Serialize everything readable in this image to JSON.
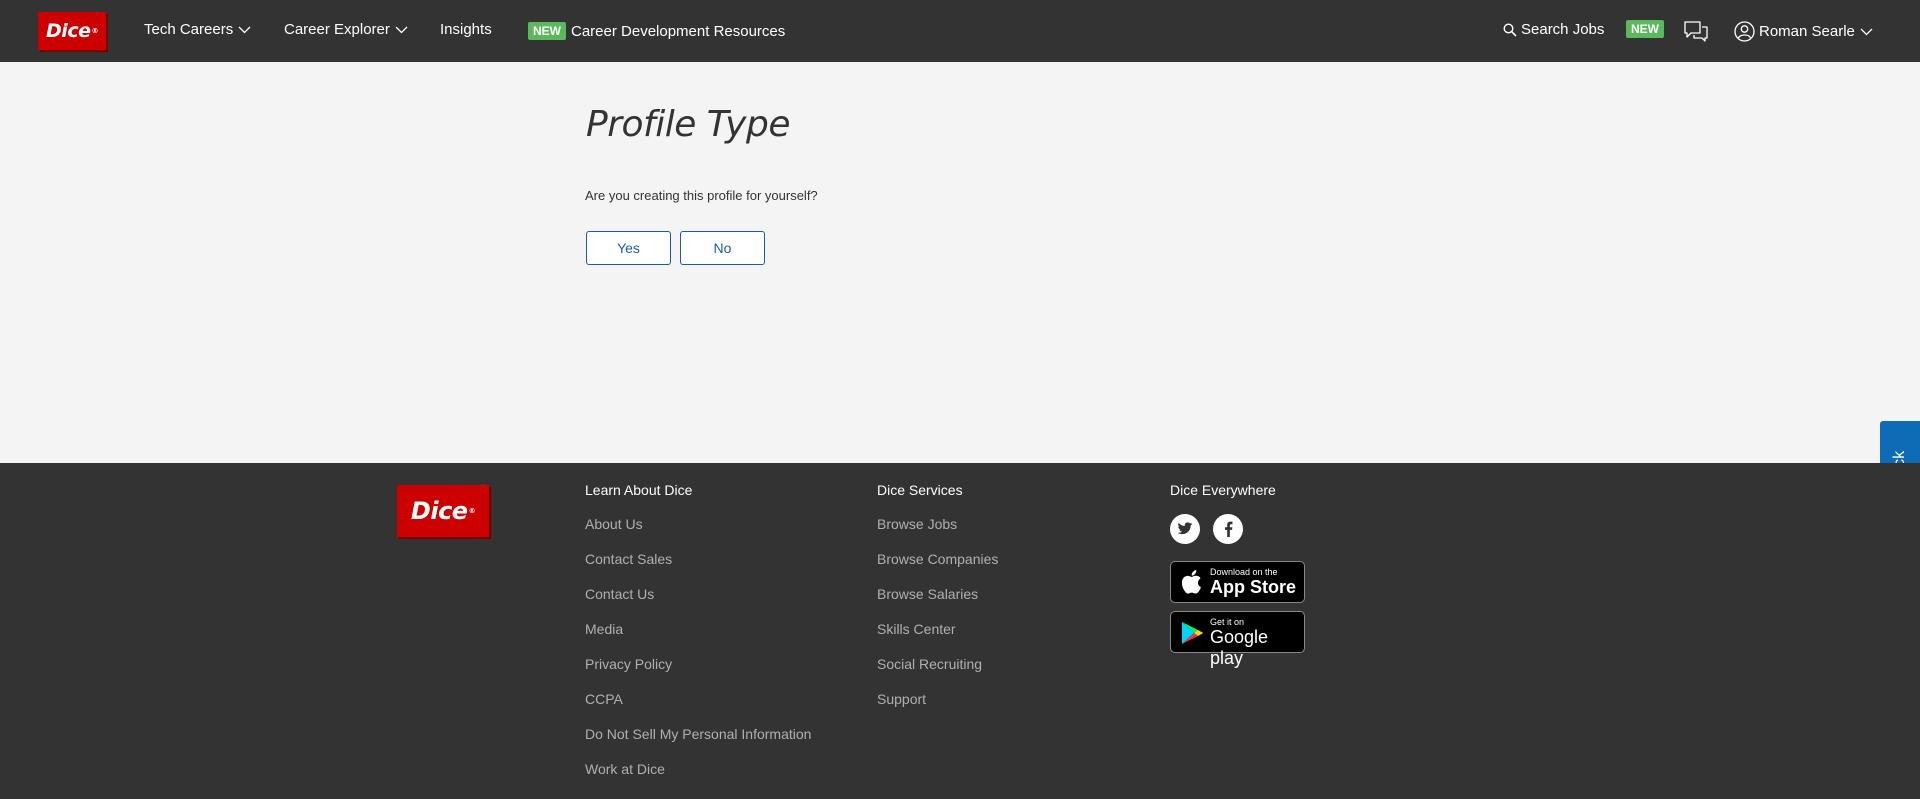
{
  "nav": {
    "logo": "Dice",
    "logo_mark": "®",
    "tech_careers": "Tech Careers",
    "career_explorer": "Career Explorer",
    "insights": "Insights",
    "new_badge": "NEW",
    "career_dev": "Career Development Resources",
    "search_jobs": "Search Jobs",
    "new_badge_right": "NEW",
    "user_name": "Roman Searle",
    "accent": "#cc0000",
    "badge_color": "#5cb85c"
  },
  "main": {
    "title": "Profile Type",
    "question": "Are you creating this profile for yourself?",
    "yes_label": "Yes",
    "no_label": "No"
  },
  "feedback": {
    "label": "Feedback",
    "color": "#0d6cb5"
  },
  "footer": {
    "logo": "Dice",
    "logo_mark": "®",
    "learn": {
      "heading": "Learn About Dice",
      "links": [
        "About Us",
        "Contact Sales",
        "Contact Us",
        "Media",
        "Privacy Policy",
        "CCPA",
        "Do Not Sell My Personal Information",
        "Work at Dice"
      ]
    },
    "services": {
      "heading": "Dice Services",
      "links": [
        "Browse Jobs",
        "Browse Companies",
        "Browse Salaries",
        "Skills Center",
        "Social Recruiting",
        "Support"
      ]
    },
    "everywhere": {
      "heading": "Dice Everywhere",
      "icons": [
        "twitter-icon",
        "facebook-icon"
      ],
      "app_store_small": "Download on the",
      "app_store_big": "App Store",
      "google_small": "Get it on",
      "google_big": "Google play"
    }
  }
}
